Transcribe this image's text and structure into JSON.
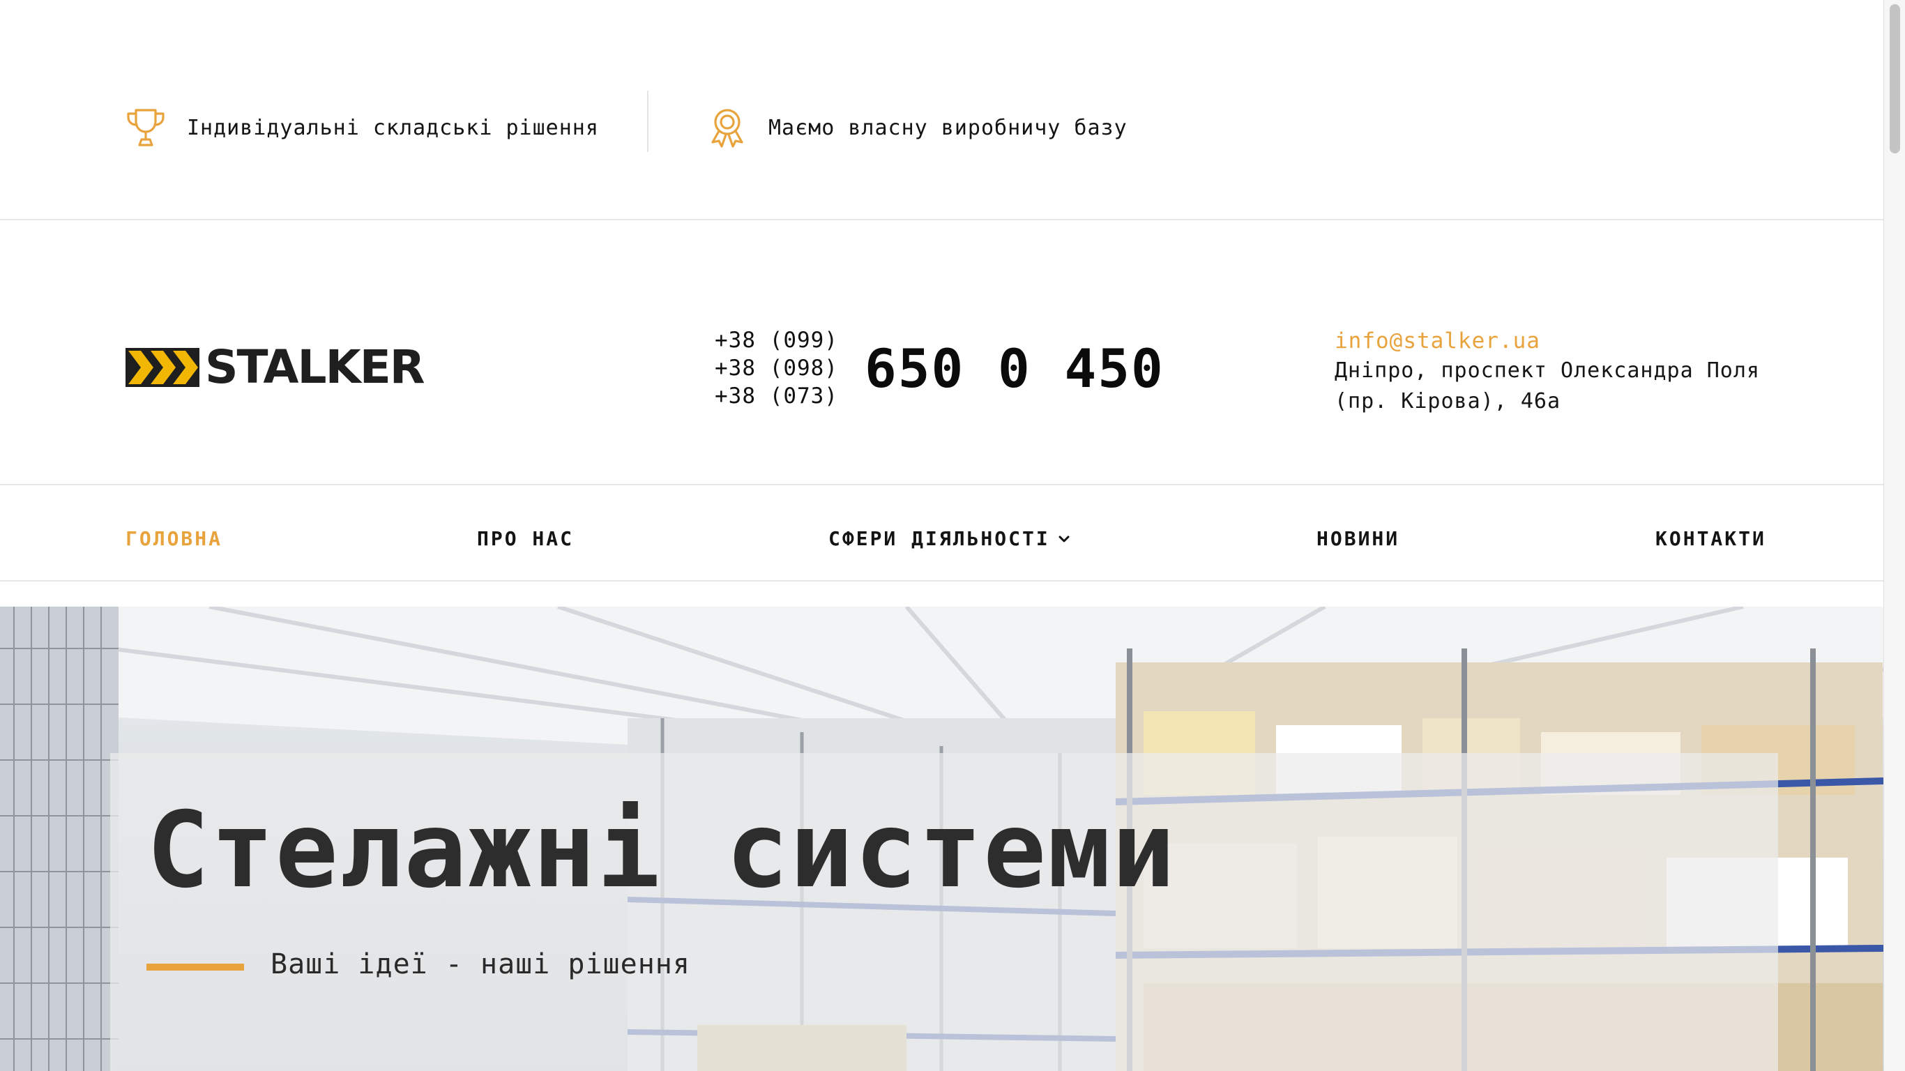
{
  "features": [
    {
      "icon": "trophy-icon",
      "text": "Індивідуальні складські рішення"
    },
    {
      "icon": "award-ribbon-icon",
      "text": "Маємо власну виробничу базу"
    }
  ],
  "header": {
    "logo_text": "STALKER",
    "phones": {
      "codes": [
        "+38 (099)",
        "+38 (098)",
        "+38 (073)"
      ],
      "number": "650 0 450"
    },
    "email": "info@stalker.ua",
    "address_line1": "Дніпро, проспект Олександра Поля",
    "address_line2": "(пр. Кірова), 46а"
  },
  "nav": {
    "items": [
      {
        "label": "ГОЛОВНА",
        "active": true
      },
      {
        "label": "ПРО НАС",
        "active": false
      },
      {
        "label": "СФЕРИ ДІЯЛЬНОСТІ",
        "active": false,
        "dropdown": true
      },
      {
        "label": "НОВИНИ",
        "active": false
      },
      {
        "label": "КОНТАКТИ",
        "active": false
      }
    ]
  },
  "hero": {
    "title": "Стелажні системи",
    "subtitle": "Ваші ідеї - наші рішення"
  },
  "colors": {
    "accent": "#e8a33d",
    "logo_mark": "#f2b705",
    "text": "#111111"
  }
}
